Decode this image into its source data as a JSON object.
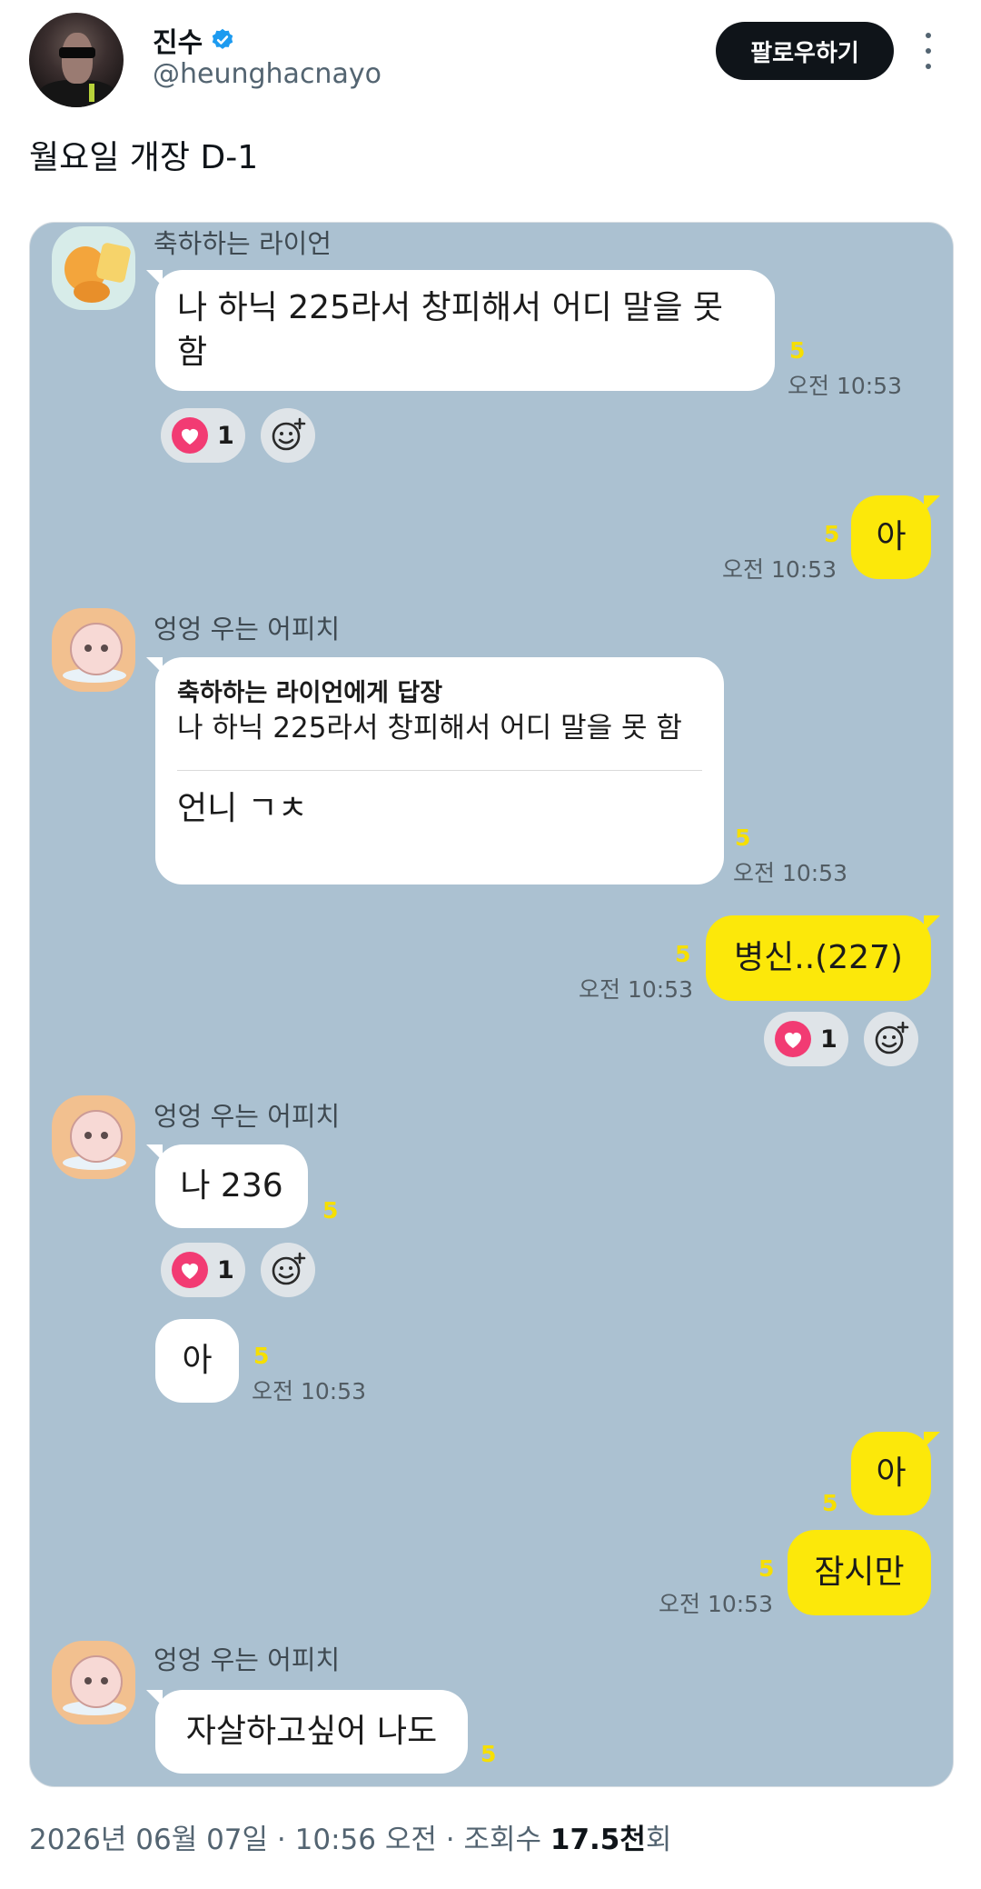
{
  "header": {
    "name": "진수",
    "handle": "@heunghacnayo",
    "follow_label": "팔로우하기"
  },
  "tweet": {
    "text": "월요일 개장 D-1"
  },
  "chat": {
    "msg1": {
      "sender": "축하하는 라이언",
      "text": "나 하닉 225라서 창피해서 어디 말을 못 함",
      "unread": "5",
      "time": "오전 10:53",
      "reaction_count": "1"
    },
    "msg2": {
      "text": "아",
      "unread": "5",
      "time": "오전 10:53"
    },
    "msg3": {
      "sender": "엉엉 우는 어피치",
      "reply_title": "축하하는 라이언에게 답장",
      "reply_preview": "나 하닉 225라서 창피해서 어디 말을 못 함",
      "text": "언니 ㄱㅊ",
      "unread": "5",
      "time": "오전 10:53"
    },
    "msg4": {
      "text": "병신..(227)",
      "unread": "5",
      "time": "오전 10:53",
      "reaction_count": "1"
    },
    "msg5": {
      "sender": "엉엉 우는 어피치",
      "text": "나 236",
      "unread": "5",
      "reaction_count": "1"
    },
    "msg6": {
      "text": "아",
      "unread": "5",
      "time": "오전 10:53"
    },
    "msg7": {
      "text": "아",
      "unread": "5"
    },
    "msg8": {
      "text": "잠시만",
      "unread": "5",
      "time": "오전 10:53"
    },
    "msg9": {
      "sender": "엉엉 우는 어피치",
      "text": "자살하고싶어 나도",
      "unread": "5"
    }
  },
  "footer": {
    "date": "2026년 06월 07일",
    "sep1": "·",
    "time": "10:56 오전",
    "sep2": "·",
    "views_label": "조회수",
    "views_value": "17.5천",
    "views_suffix": "회"
  },
  "colors": {
    "chat_bg": "#abc1d1",
    "my_bubble": "#fce80a",
    "unread": "#f6df00",
    "heart": "#f23b73",
    "verified": "#1d9bf0"
  }
}
